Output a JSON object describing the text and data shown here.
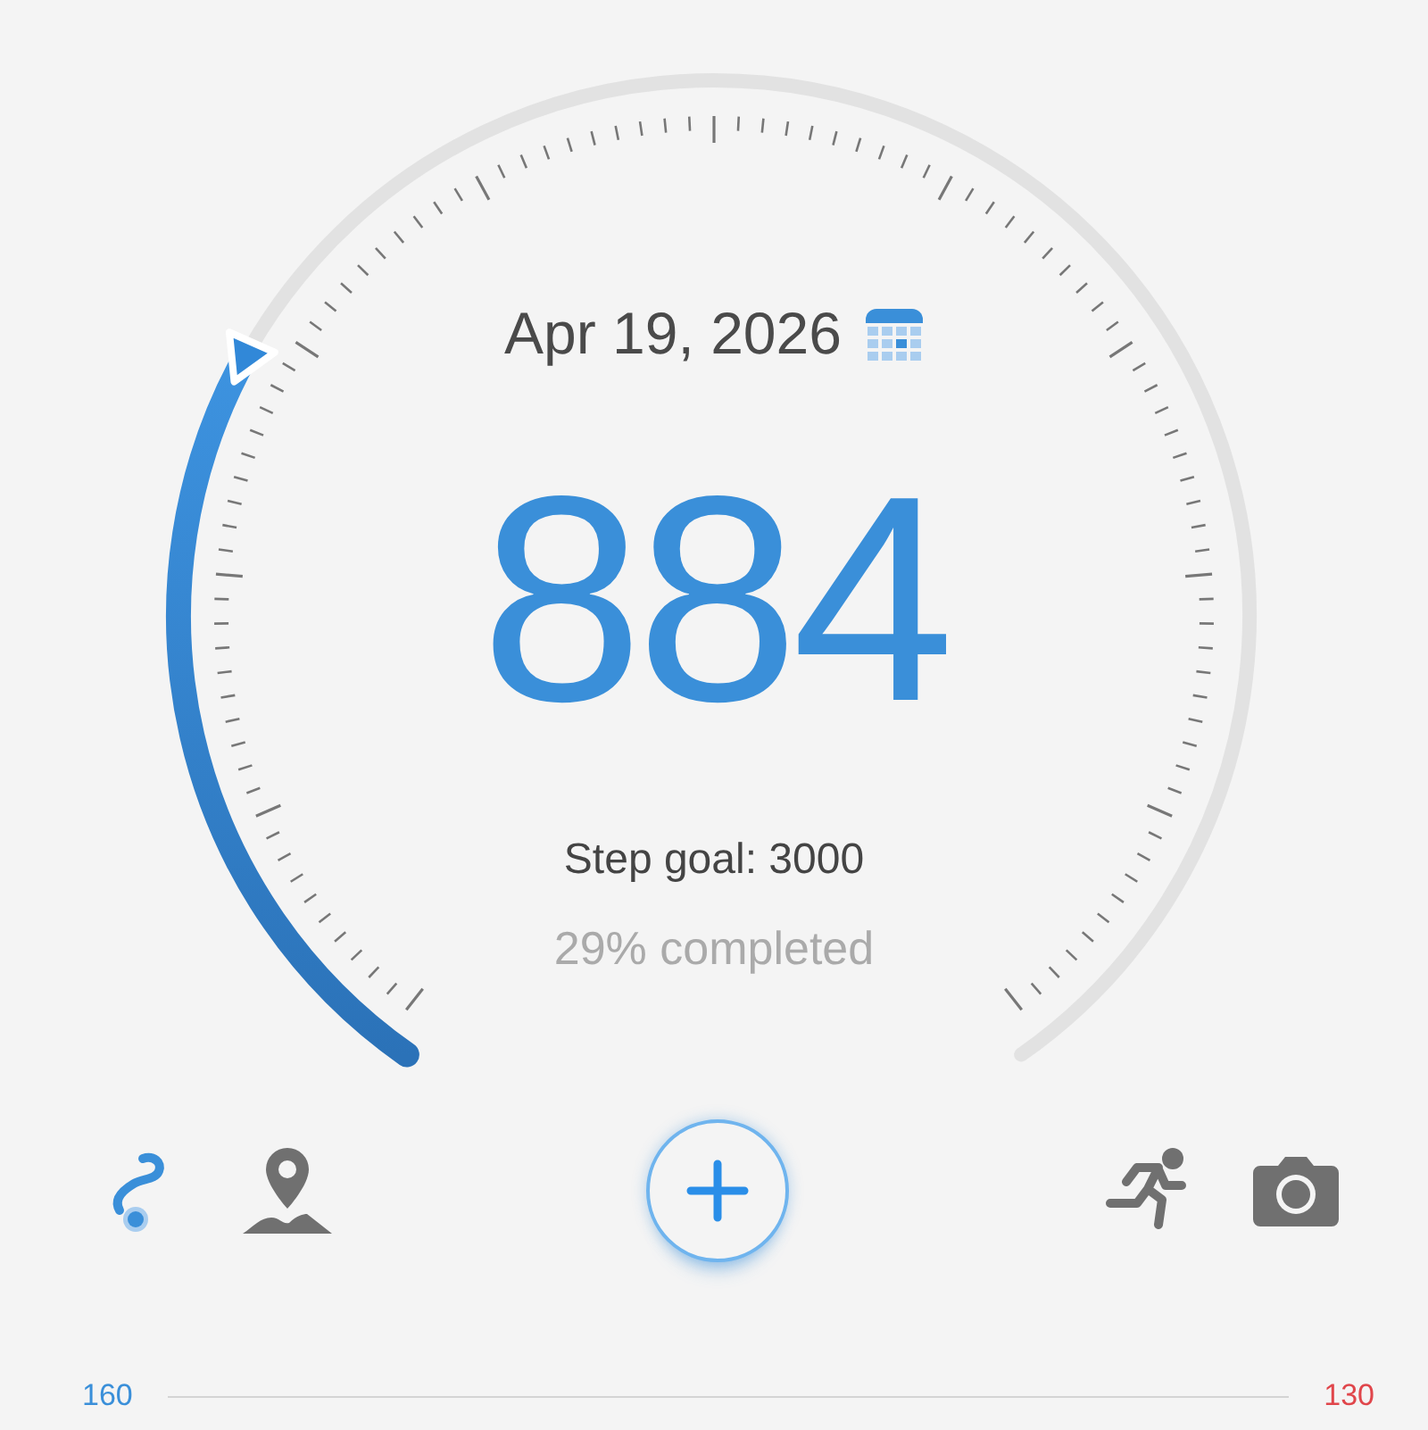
{
  "gauge": {
    "date": "Apr 19, 2026",
    "steps": "884",
    "goal": "Step goal: 3000",
    "completed": "29% completed"
  },
  "toolbar": [
    {
      "kind": "route",
      "selected": true
    },
    {
      "kind": "map",
      "selected": false
    },
    {
      "kind": "add",
      "selected": false
    },
    {
      "kind": "run",
      "selected": false
    },
    {
      "kind": "camera",
      "selected": false
    }
  ],
  "scale": [
    {
      "text": "160",
      "color": "#3a8fd9"
    },
    {
      "text": "130",
      "color": "#e0464b"
    }
  ]
}
